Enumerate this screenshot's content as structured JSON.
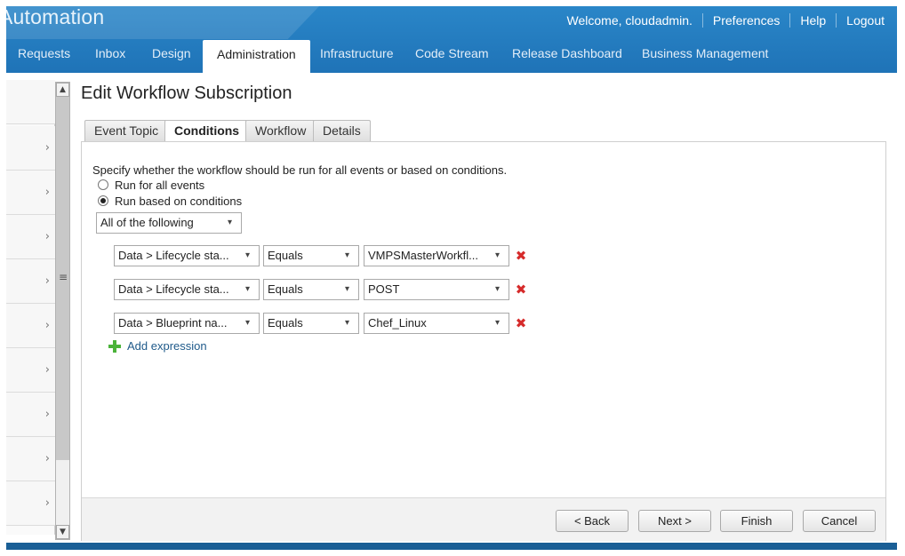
{
  "header": {
    "brand": "Automation",
    "links": [
      "Welcome, cloudadmin.",
      "Preferences",
      "Help",
      "Logout"
    ]
  },
  "nav": {
    "items": [
      "Requests",
      "Inbox",
      "Design",
      "Administration",
      "Infrastructure",
      "Code Stream",
      "Release Dashboard",
      "Business Management"
    ],
    "active": "Administration"
  },
  "page": {
    "title": "Edit Workflow Subscription",
    "tabs": [
      "Event Topic",
      "Conditions",
      "Workflow",
      "Details"
    ],
    "active_tab": "Conditions"
  },
  "conditions": {
    "instruction": "Specify whether the workflow should be run for all events or based on conditions.",
    "run_all_label": "Run for all events",
    "run_conditions_label": "Run based on conditions",
    "selected_mode": "Run based on conditions",
    "logic": "All of the following",
    "rows": [
      {
        "field": "Data > Lifecycle sta...",
        "operator": "Equals",
        "value": "VMPSMasterWorkfl..."
      },
      {
        "field": "Data > Lifecycle sta...",
        "operator": "Equals",
        "value": "POST"
      },
      {
        "field": "Data > Blueprint na...",
        "operator": "Equals",
        "value": "Chef_Linux"
      }
    ],
    "add_expression": "Add expression"
  },
  "footer": {
    "back": "< Back",
    "next": "Next >",
    "finish": "Finish",
    "cancel": "Cancel"
  },
  "icons": {
    "chevron": "chevron-right-icon",
    "delete": "delete-x-icon",
    "add": "green-plus-icon"
  },
  "colors": {
    "header_blue": "#1f73b7",
    "delete_red": "#d62b2b",
    "add_green": "#4bb33a",
    "link_blue": "#1f5a8a"
  }
}
